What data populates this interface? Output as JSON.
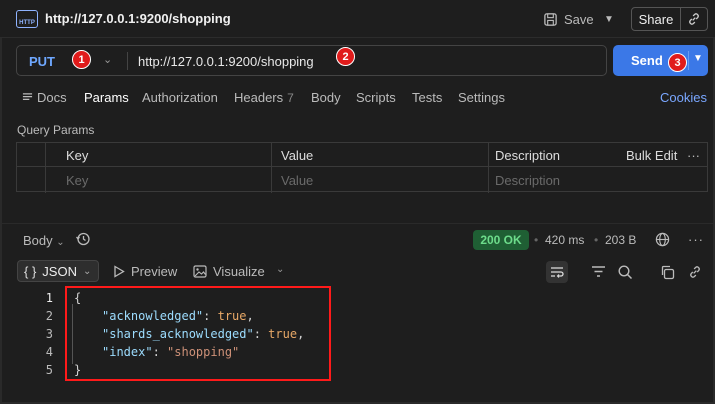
{
  "header": {
    "title": "http://127.0.0.1:9200/shopping",
    "app_icon_text": "HTTP",
    "save_label": "Save",
    "share_label": "Share"
  },
  "request": {
    "method": "PUT",
    "url": "http://127.0.0.1:9200/shopping",
    "send_label": "Send"
  },
  "badges": [
    "1",
    "2",
    "3"
  ],
  "tabs": [
    {
      "label": "Docs"
    },
    {
      "label": "Params"
    },
    {
      "label": "Authorization"
    },
    {
      "label": "Headers",
      "count": "7"
    },
    {
      "label": "Body"
    },
    {
      "label": "Scripts"
    },
    {
      "label": "Tests"
    },
    {
      "label": "Settings"
    }
  ],
  "cookies_label": "Cookies",
  "query_params": {
    "title": "Query Params",
    "columns": [
      "Key",
      "Value",
      "Description"
    ],
    "bulk_edit": "Bulk Edit",
    "placeholders": [
      "Key",
      "Value",
      "Description"
    ]
  },
  "response": {
    "body_label": "Body",
    "status": "200 OK",
    "time": "420 ms",
    "size": "203 B",
    "format": "JSON",
    "preview_label": "Preview",
    "visualize_label": "Visualize",
    "lines": [
      "1",
      "2",
      "3",
      "4",
      "5"
    ],
    "code": {
      "l1": "{",
      "k1": "\"acknowledged\"",
      "v1": "true",
      "k2": "\"shards_acknowledged\"",
      "v2": "true",
      "k3": "\"index\"",
      "v3": "\"shopping\"",
      "l5": "}"
    }
  },
  "colors": {
    "accent": "#3b78e7",
    "method": "#6fa8ff",
    "status_bg": "#1f5f34",
    "annotation": "#e01b1b"
  }
}
